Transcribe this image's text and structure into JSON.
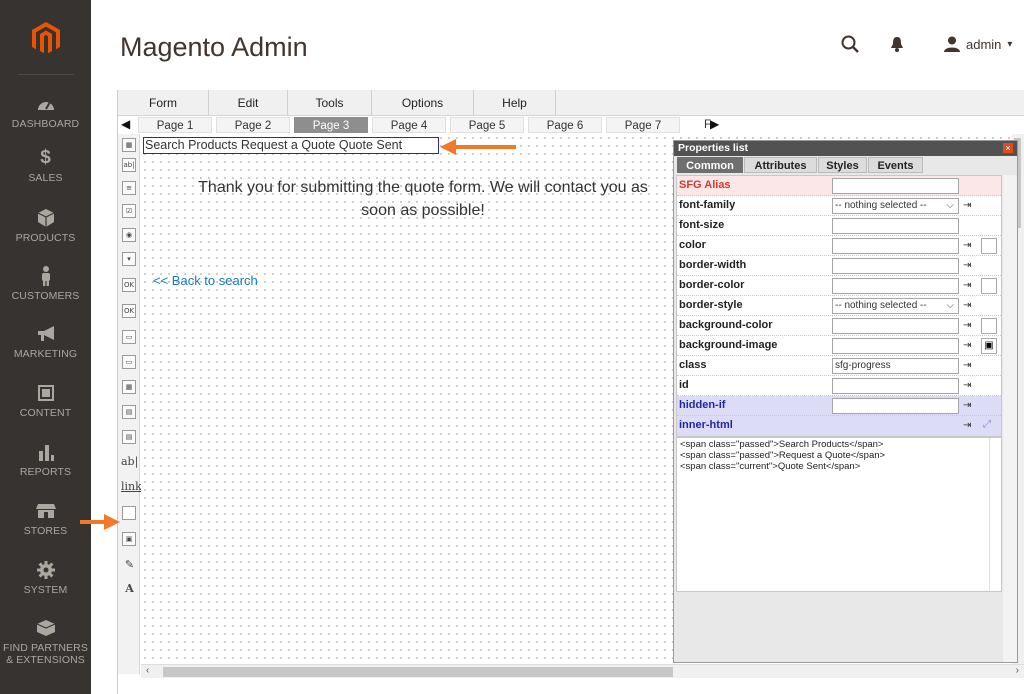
{
  "sidebar": {
    "items": [
      {
        "label": "DASHBOARD",
        "icon": "dashboard-icon"
      },
      {
        "label": "SALES",
        "icon": "dollar-icon"
      },
      {
        "label": "PRODUCTS",
        "icon": "cube-icon"
      },
      {
        "label": "CUSTOMERS",
        "icon": "person-icon"
      },
      {
        "label": "MARKETING",
        "icon": "megaphone-icon"
      },
      {
        "label": "CONTENT",
        "icon": "layout-icon"
      },
      {
        "label": "REPORTS",
        "icon": "bar-chart-icon"
      },
      {
        "label": "STORES",
        "icon": "store-icon"
      },
      {
        "label": "SYSTEM",
        "icon": "gear-icon"
      },
      {
        "label_line1": "FIND PARTNERS",
        "label_line2": "& EXTENSIONS",
        "icon": "box-icon"
      }
    ]
  },
  "header": {
    "title": "Magento Admin",
    "user": "admin",
    "user_caret": "▾"
  },
  "menubar": {
    "items": [
      "Form",
      "Edit",
      "Tools",
      "Options",
      "Help"
    ]
  },
  "pagebar": {
    "prev": "◀",
    "tabs": [
      "Page 1",
      "Page 2",
      "Page 3",
      "Page 4",
      "Page 5",
      "Page 6",
      "Page 7"
    ],
    "active_index": 2,
    "overflow_label": "F",
    "next": "▶"
  },
  "canvas": {
    "breadcrumb_text": "Search Products Request a Quote Quote Sent",
    "message_line1": "Thank you for submitting the quote form. We will contact you as",
    "message_line2": "soon as possible!",
    "back_link": "<< Back to search"
  },
  "tools": [
    {
      "label": "ab|",
      "name": "textbox-tool"
    },
    {
      "label": "≡",
      "name": "textarea-tool"
    },
    {
      "label": "☑",
      "name": "checkbox-tool"
    },
    {
      "label": "◉",
      "name": "radio-tool"
    },
    {
      "label": "▾",
      "name": "select-tool"
    },
    {
      "label": "OK",
      "name": "submit-button-tool"
    },
    {
      "label": "OK",
      "name": "button-tool"
    },
    {
      "label": "▭",
      "name": "frame-tool"
    },
    {
      "label": "▭",
      "name": "group-tool"
    },
    {
      "label": "▦",
      "name": "table-tool"
    },
    {
      "label": "▤",
      "name": "list-tool"
    },
    {
      "label": "▤",
      "name": "grid-tool"
    },
    {
      "label": "ab|",
      "name": "label-tool"
    },
    {
      "label": "link",
      "name": "link-tool"
    },
    {
      "label": "",
      "name": "html-block-tool"
    },
    {
      "label": "▣",
      "name": "image-tool"
    },
    {
      "label": "✎",
      "name": "signature-tool"
    },
    {
      "label": "A",
      "name": "captcha-tool"
    }
  ],
  "properties": {
    "title": "Properties list",
    "close": "×",
    "tabs": [
      "Common",
      "Attributes",
      "Styles",
      "Events"
    ],
    "active_tab": 0,
    "rows": [
      {
        "label": "SFG Alias",
        "value": "",
        "kind": "input",
        "style": "pink-red"
      },
      {
        "label": "font-family",
        "value": "-- nothing selected --",
        "kind": "select"
      },
      {
        "label": "font-size",
        "value": "",
        "kind": "input"
      },
      {
        "label": "color",
        "value": "",
        "kind": "input-swatch"
      },
      {
        "label": "border-width",
        "value": "",
        "kind": "input"
      },
      {
        "label": "border-color",
        "value": "",
        "kind": "input-swatch"
      },
      {
        "label": "border-style",
        "value": "-- nothing selected --",
        "kind": "select"
      },
      {
        "label": "background-color",
        "value": "",
        "kind": "input-swatch"
      },
      {
        "label": "background-image",
        "value": "",
        "kind": "input-image"
      },
      {
        "label": "class",
        "value": "sfg-progress",
        "kind": "input"
      },
      {
        "label": "id",
        "value": "",
        "kind": "input"
      },
      {
        "label": "hidden-if",
        "value": "",
        "kind": "input",
        "style": "lav-blue"
      },
      {
        "label": "inner-html",
        "value": "",
        "kind": "expand",
        "style": "lav-blue"
      }
    ],
    "inner_html_lines": [
      "<span class=\"passed\">Search Products</span>",
      "<span class=\"passed\">Request a Quote</span>",
      "<span class=\"current\">Quote Sent</span>"
    ]
  },
  "colors": {
    "sidebar_bg": "#373330",
    "logo_orange": "#eb5202",
    "callout_orange": "#f07a2a",
    "link_blue": "#1979c3"
  }
}
